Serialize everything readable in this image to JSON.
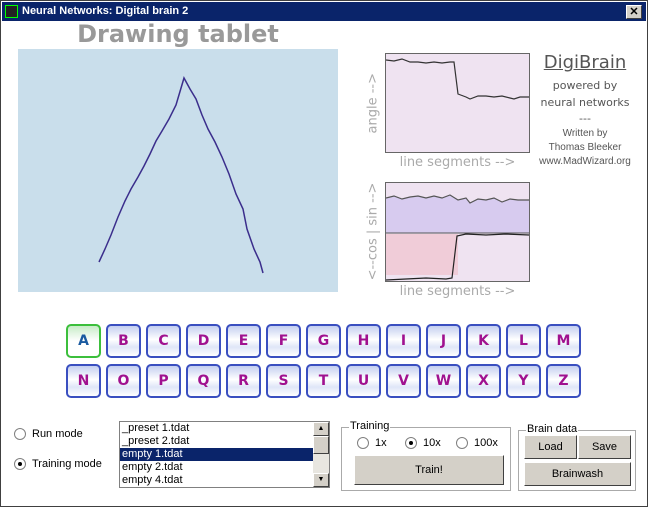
{
  "window": {
    "title": "Neural Networks: Digital brain 2",
    "close": "✕"
  },
  "tablet": {
    "title": "Drawing tablet",
    "background": "#c9deeb",
    "stroke": "#3b2e8c"
  },
  "graphs": {
    "angle_label": "angle -->",
    "sincos_label": "<--cos | sin -->",
    "x_label": "line segments -->"
  },
  "brand": {
    "name": "DigiBrain",
    "line1": "powered by",
    "line2": "neural networks",
    "sep": "---",
    "line3": "Written by",
    "author": "Thomas Bleeker",
    "url": "www.MadWizard.org"
  },
  "letters": [
    "A",
    "B",
    "C",
    "D",
    "E",
    "F",
    "G",
    "H",
    "I",
    "J",
    "K",
    "L",
    "M",
    "N",
    "O",
    "P",
    "Q",
    "R",
    "S",
    "T",
    "U",
    "V",
    "W",
    "X",
    "Y",
    "Z"
  ],
  "selected_letter": "A",
  "mode": {
    "run": "Run mode",
    "training": "Training mode",
    "selected": "training"
  },
  "files": {
    "items": [
      "_preset 1.tdat",
      "_preset 2.tdat",
      "empty 1.tdat",
      "empty 2.tdat",
      "empty 4.tdat"
    ],
    "selected": "empty 1.tdat"
  },
  "training": {
    "label": "Training",
    "options": [
      "1x",
      "10x",
      "100x"
    ],
    "selected": "10x",
    "train": "Train!"
  },
  "brain": {
    "label": "Brain data",
    "load": "Load",
    "save": "Save",
    "brainwash": "Brainwash"
  }
}
